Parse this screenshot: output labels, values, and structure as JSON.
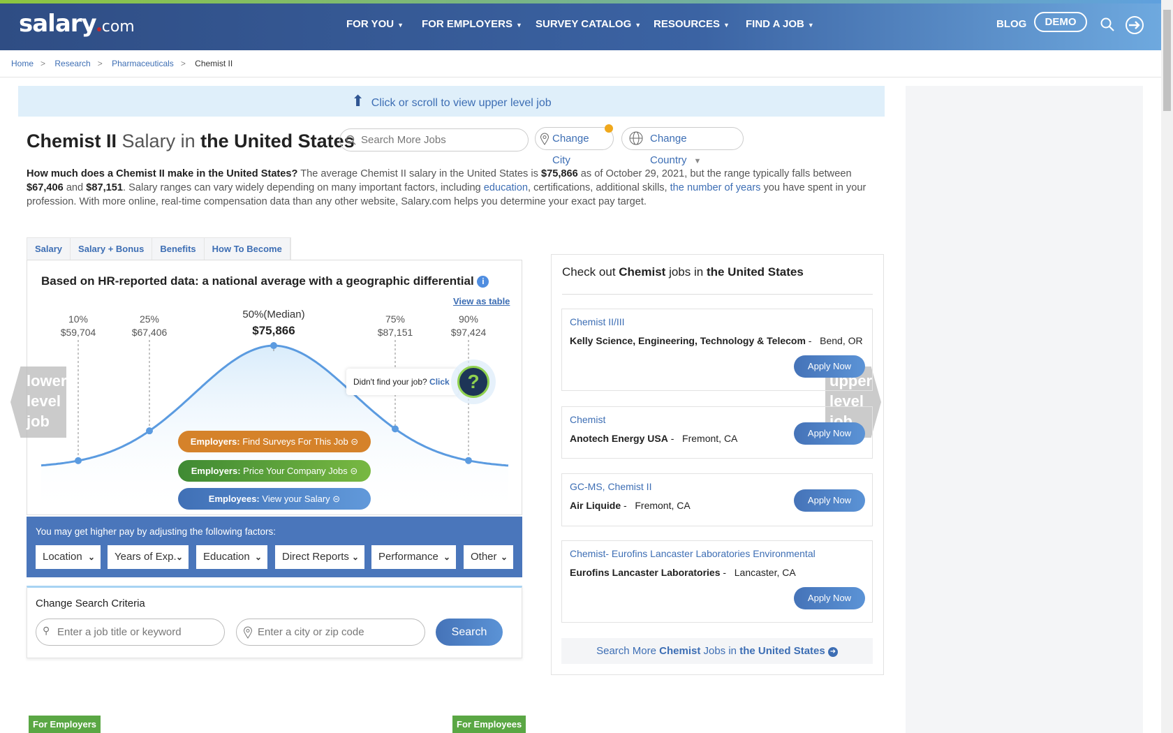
{
  "header": {
    "logo": "salary.com",
    "nav": [
      "FOR YOU",
      "FOR EMPLOYERS",
      "SURVEY CATALOG",
      "RESOURCES",
      "FIND A JOB"
    ],
    "blog": "BLOG",
    "demo": "DEMO"
  },
  "breadcrumb": [
    "Home",
    "Research",
    "Pharmaceuticals",
    "Chemist II"
  ],
  "banner": "Click or scroll to view upper level job",
  "title": {
    "job": "Chemist II",
    "mid": " Salary in ",
    "place": "the United States"
  },
  "search_more_placeholder": "Search More Jobs",
  "change_city": "Change City",
  "change_country": "Change Country",
  "intro": {
    "q": "How much does a Chemist II make in the United States?",
    "t1": " The average Chemist II salary in the United States is ",
    "avg": "$75,866",
    "t2": " as of October 29, 2021, but the range typically falls between ",
    "low": "$67,406",
    "t3": " and ",
    "high": "$87,151",
    "t4": ". Salary ranges can vary widely depending on many important factors, including ",
    "l1": "education",
    "t5": ", certifications, additional skills, ",
    "l2": "the number of years",
    "t6": " you have spent in your profession. With more online, real-time compensation data than any other website, Salary.com helps you determine your exact pay target."
  },
  "tabs": [
    "Salary",
    "Salary + Bonus",
    "Benefits",
    "How To Become"
  ],
  "chart": {
    "heading": "Based on HR-reported data: a national average with a geographic differential",
    "view_table": "View as table",
    "percentiles": [
      {
        "label": "10%",
        "value": "$59,704"
      },
      {
        "label": "25%",
        "value": "$67,406"
      },
      {
        "label": "50%(Median)",
        "value": "$75,866"
      },
      {
        "label": "75%",
        "value": "$87,151"
      },
      {
        "label": "90%",
        "value": "$97,424"
      }
    ],
    "didnt_find": "Didn't find your job?",
    "click": "Click",
    "btn1": {
      "b": "Employers:",
      "t": " Find Surveys For This Job"
    },
    "btn2": {
      "b": "Employers:",
      "t": " Price Your Company Jobs"
    },
    "btn3": {
      "b": "Employees:",
      "t": " View your Salary"
    },
    "lower": "lower level job",
    "upper": "upper level job"
  },
  "factors": {
    "label": "You may get higher pay by adjusting the following factors:",
    "options": [
      "Location",
      "Years of Exp.",
      "Education",
      "Direct Reports",
      "Performance",
      "Other"
    ]
  },
  "criteria": {
    "title": "Change Search Criteria",
    "job_placeholder": "Enter a job title or keyword",
    "city_placeholder": "Enter a city or zip code",
    "search": "Search"
  },
  "jobs": {
    "h1": "Check out ",
    "hb": "Chemist",
    "h2": " jobs in ",
    "hp": "the United States",
    "items": [
      {
        "title": "Chemist II/III",
        "company": "Kelly Science, Engineering, Technology & Telecom",
        "loc": "Bend, OR"
      },
      {
        "title": "Chemist",
        "company": "Anotech Energy USA",
        "loc": "Fremont, CA"
      },
      {
        "title": "GC-MS, Chemist II",
        "company": "Air Liquide",
        "loc": "Fremont, CA"
      },
      {
        "title": "Chemist- Eurofins Lancaster Laboratories Environmental",
        "company": "Eurofins Lancaster Laboratories",
        "loc": "Lancaster, CA"
      }
    ],
    "apply": "Apply Now",
    "more1": "Search More ",
    "more_b": "Chemist",
    "more2": " Jobs in ",
    "more_p": "the United States"
  },
  "bottom": {
    "employers": "For Employers",
    "employees": "For Employees"
  }
}
